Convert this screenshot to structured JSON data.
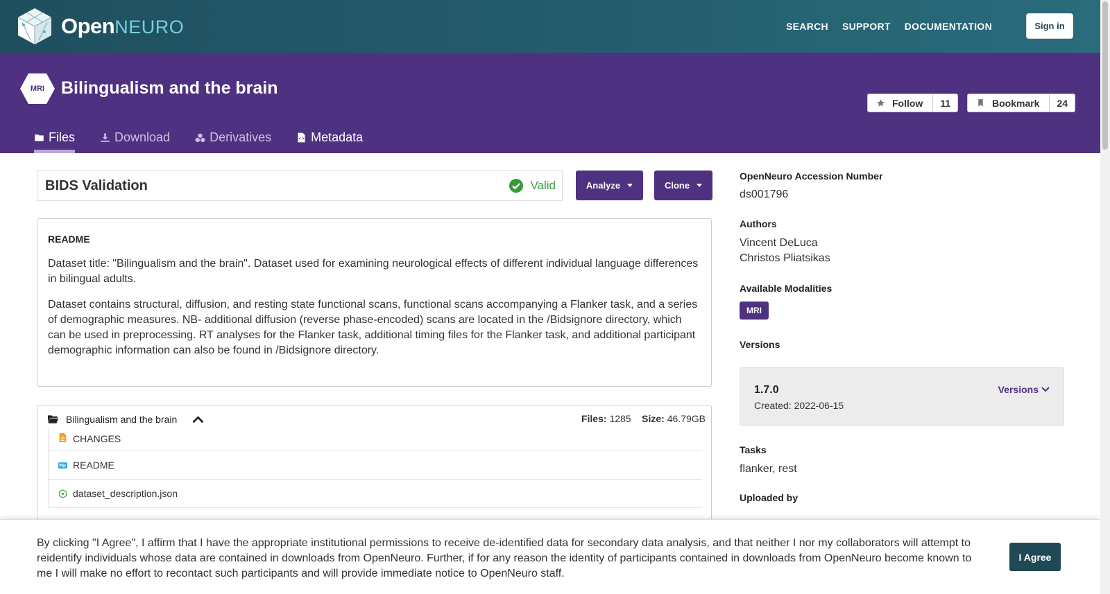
{
  "nav": {
    "logo_open": "Open",
    "logo_neuro": "NEURO",
    "links": [
      "SEARCH",
      "SUPPORT",
      "DOCUMENTATION"
    ],
    "signin": "Sign in"
  },
  "dataset": {
    "modality_hex": "MRI",
    "title": "Bilingualism and the brain",
    "follow_label": "Follow",
    "follow_count": "11",
    "bookmark_label": "Bookmark",
    "bookmark_count": "24",
    "tabs": [
      "Files",
      "Download",
      "Derivatives",
      "Metadata"
    ]
  },
  "validation": {
    "title": "BIDS Validation",
    "status": "Valid",
    "status_color": "#3a9a3a"
  },
  "actions": {
    "analyze": "Analyze",
    "clone": "Clone"
  },
  "readme": {
    "label": "README",
    "p1": "Dataset title: \"Bilingualism and the brain\". Dataset used for examining neurological effects of different individual language differences in bilingual adults.",
    "p2": "Dataset contains structural, diffusion, and resting state functional scans, functional scans accompanying a Flanker task, and a series of demographic measures. NB- additional diffusion (reverse phase-encoded) scans are located in the /Bidsignore directory, which can be used in preprocessing. RT analyses for the Flanker task, additional timing files for the Flanker task, and additional participant demographic information can also be found in /Bidsignore directory."
  },
  "files": {
    "root": "Bilingualism and the brain",
    "files_label": "Files:",
    "files_count": "1285",
    "size_label": "Size:",
    "size_value": "46.79GB",
    "items": [
      "CHANGES",
      "README",
      "dataset_description.json"
    ]
  },
  "side": {
    "accession_label": "OpenNeuro Accession Number",
    "accession": "ds001796",
    "authors_label": "Authors",
    "authors": [
      "Vincent DeLuca",
      "Christos Pliatsikas"
    ],
    "modalities_label": "Available Modalities",
    "modality": "MRI",
    "versions_label": "Versions",
    "version": "1.7.0",
    "created": "Created: 2022-06-15",
    "versions_link": "Versions",
    "tasks_label": "Tasks",
    "tasks": "flanker, rest",
    "uploaded_label": "Uploaded by"
  },
  "agreement": {
    "text": "By clicking \"I Agree\", I affirm that I have the appropriate institutional permissions to receive de-identified data for secondary data analysis, and that neither I nor my collaborators will attempt to reidentify individuals whose data are contained in downloads from OpenNeuro. Further, if for any reason the identity of participants contained in downloads from OpenNeuro become known to me I will make no effort to recontact such participants and will provide immediate notice to OpenNeuro staff.",
    "button": "I Agree"
  },
  "colors": {
    "header_purple": "#4f3181",
    "nav_teal": "#235a6a",
    "agree_btn": "#1f4a55"
  }
}
